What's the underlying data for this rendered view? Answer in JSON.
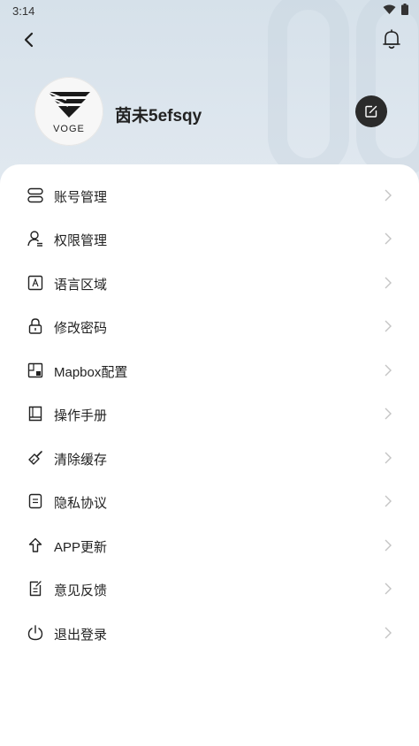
{
  "status_bar": {
    "time": "3:14"
  },
  "profile": {
    "name": "茵未5efsqy",
    "logo_text": "VOGE"
  },
  "menu": [
    {
      "label": "账号管理",
      "icon": "account-icon"
    },
    {
      "label": "权限管理",
      "icon": "permission-icon"
    },
    {
      "label": "语言区域",
      "icon": "language-icon"
    },
    {
      "label": "修改密码",
      "icon": "lock-icon"
    },
    {
      "label": "Mapbox配置",
      "icon": "map-icon"
    },
    {
      "label": "操作手册",
      "icon": "manual-icon"
    },
    {
      "label": "清除缓存",
      "icon": "broom-icon"
    },
    {
      "label": "隐私协议",
      "icon": "document-icon"
    },
    {
      "label": "APP更新",
      "icon": "upload-icon"
    },
    {
      "label": "意见反馈",
      "icon": "feedback-icon"
    },
    {
      "label": "退出登录",
      "icon": "power-icon"
    }
  ],
  "colors": {
    "header_bg": "#d6e1ea",
    "edit_button": "#2b2b2b",
    "chevron": "#c4c4c4"
  }
}
